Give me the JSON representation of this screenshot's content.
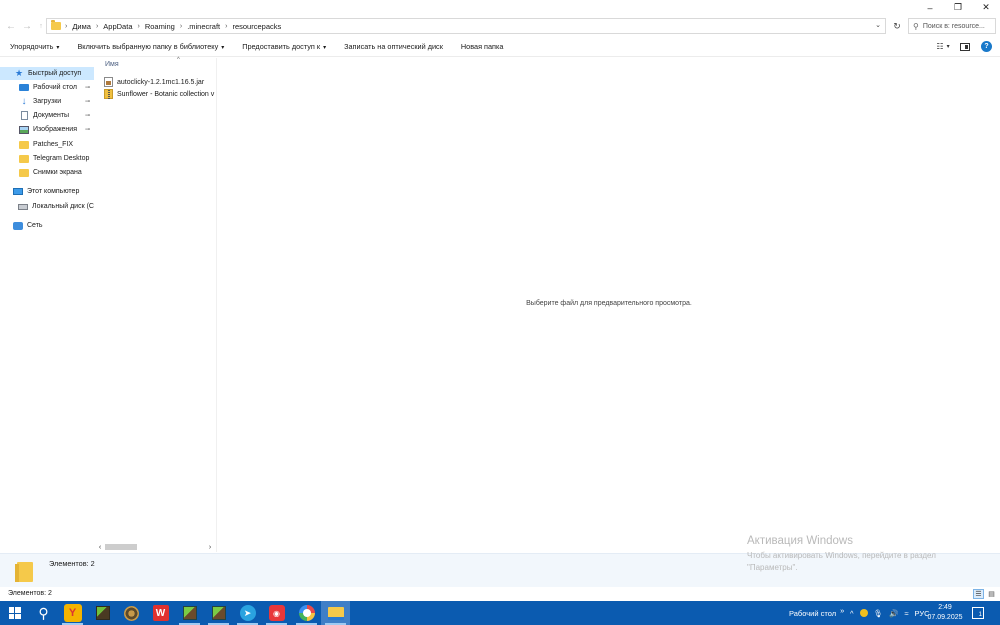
{
  "window": {
    "controls": {
      "minimize": "–",
      "restore": "❐",
      "close": "✕"
    }
  },
  "address_bar": {
    "back_icon": "back-arrow-icon",
    "forward_icon": "forward-arrow-icon",
    "up_icon": "up-arrow-icon",
    "breadcrumbs": [
      "Дима",
      "AppData",
      "Roaming",
      ".minecraft",
      "resourcepacks"
    ],
    "separator": "›",
    "dropdown": "⌄",
    "refresh": "↻"
  },
  "search": {
    "placeholder": "Поиск в: resource..."
  },
  "command_bar": {
    "organize": "Упорядочить",
    "include_library": "Включить выбранную папку в библиотеку",
    "share_with": "Предоставить доступ к",
    "burn": "Записать на оптический диск",
    "new_folder": "Новая папка",
    "caret": "▾",
    "view_caret": "▾"
  },
  "nav_pane": {
    "items": [
      {
        "label": "Быстрый доступ",
        "icon": "star-icon",
        "pinned": false,
        "selected": true
      },
      {
        "label": "Рабочий стол",
        "icon": "desktop-icon",
        "pinned": true
      },
      {
        "label": "Загрузки",
        "icon": "download-icon",
        "pinned": true
      },
      {
        "label": "Документы",
        "icon": "documents-icon",
        "pinned": true
      },
      {
        "label": "Изображения",
        "icon": "pictures-icon",
        "pinned": true
      },
      {
        "label": "Patches_FIX",
        "icon": "folder-icon",
        "pinned": false
      },
      {
        "label": "Telegram Desktop",
        "icon": "folder-icon",
        "pinned": false
      },
      {
        "label": "Снимки экрана",
        "icon": "folder-icon",
        "pinned": false
      },
      {
        "label": "Этот компьютер",
        "icon": "computer-icon",
        "pinned": false
      },
      {
        "label": "Локальный диск (C",
        "icon": "drive-icon",
        "pinned": false
      },
      {
        "label": "Сеть",
        "icon": "network-icon",
        "pinned": false
      }
    ],
    "pin_glyph": "📌"
  },
  "file_list": {
    "column_name": "Имя",
    "sort_glyph": "^",
    "files": [
      {
        "name": "autoclicky-1.2.1mc1.16.5.jar",
        "icon": "jar-file-icon"
      },
      {
        "name": "Sunflower - Botanic collection v",
        "icon": "zip-file-icon"
      }
    ],
    "scroll_left": "‹",
    "scroll_right": "›"
  },
  "preview": {
    "message": "Выберите файл для предварительного просмотра."
  },
  "details": {
    "items_count": "Элементов: 2"
  },
  "watermark": {
    "line1": "Активация Windows",
    "line2": "Чтобы активировать Windows, перейдите в раздел \"Параметры\"."
  },
  "status_bar": {
    "items_count": "Элементов: 2"
  },
  "taskbar": {
    "apps": [
      {
        "name": "start-icon"
      },
      {
        "name": "search-icon"
      },
      {
        "name": "yandex-browser-icon"
      },
      {
        "name": "minecraft-icon"
      },
      {
        "name": "minecraft-mod-icon"
      },
      {
        "name": "wps-office-icon"
      },
      {
        "name": "minecraft-launcher-icon"
      },
      {
        "name": "minecraft-launcher-2-icon"
      },
      {
        "name": "telegram-icon"
      },
      {
        "name": "screen-recorder-icon"
      },
      {
        "name": "color-app-icon"
      },
      {
        "name": "file-explorer-icon"
      }
    ],
    "desktop_toolbar": "Рабочий стол",
    "toolbar_chevron": "»",
    "tray_up": "^",
    "language": "РУС",
    "time": "2:49",
    "date": "07.09.2025",
    "notifications": "1"
  }
}
